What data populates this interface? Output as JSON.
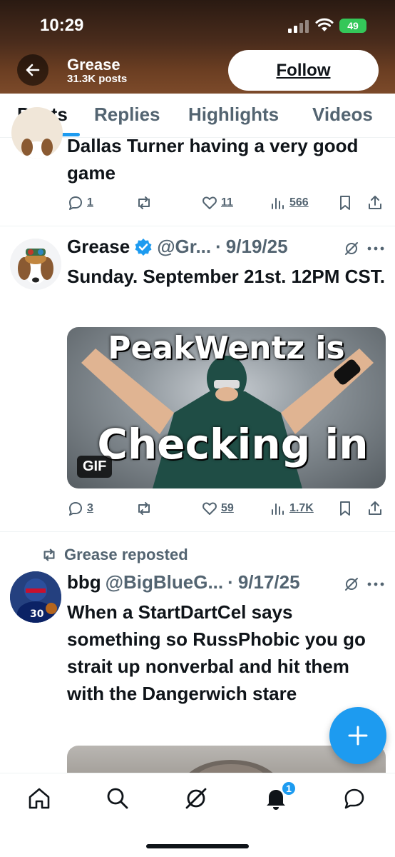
{
  "status_bar": {
    "time": "10:29",
    "battery": "49"
  },
  "header": {
    "name": "Grease",
    "post_count": "31.3K posts",
    "follow_label": "Follow"
  },
  "tabs": [
    {
      "label": "Posts",
      "active": true
    },
    {
      "label": "Replies",
      "active": false
    },
    {
      "label": "Highlights",
      "active": false
    },
    {
      "label": "Videos",
      "active": false
    }
  ],
  "posts": [
    {
      "text": "Dallas Turner having a very good game",
      "replies": "1",
      "likes": "11",
      "views": "566"
    },
    {
      "name": "Grease",
      "handle": "@Gr...",
      "date": "9/19/25",
      "text": "Sunday. September 21st. 12PM CST.",
      "media_caption_top": "PeakWentz is",
      "media_caption_bottom": "Checking in",
      "media_badge": "GIF",
      "replies": "3",
      "likes": "59",
      "views": "1.7K"
    },
    {
      "repost_label": "Grease reposted",
      "name": "bbg",
      "handle": "@BigBlueG...",
      "date": "9/17/25",
      "text": "When a StartDartCel says something so RussPhobic you go strait up nonverbal and hit them with the Dangerwich stare"
    }
  ],
  "nav": {
    "notification_count": "1"
  },
  "colors": {
    "accent": "#1d9bf0",
    "text": "#0f1419",
    "muted": "#536471"
  }
}
